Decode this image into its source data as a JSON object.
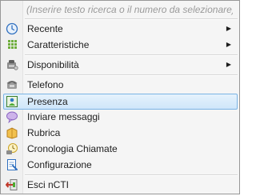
{
  "menu": {
    "search": {
      "placeholder": "(Inserire testo ricerca o il numero da selezionare)"
    },
    "items": [
      {
        "label": "Recente",
        "icon": "clock-icon",
        "submenu": true
      },
      {
        "label": "Caratteristiche",
        "icon": "grid-icon",
        "submenu": true
      },
      {
        "label": "Disponibilità",
        "icon": "phone-status-icon",
        "submenu": true
      },
      {
        "label": "Telefono",
        "icon": "telephone-icon",
        "submenu": false
      },
      {
        "label": "Presenza",
        "icon": "presence-icon",
        "submenu": false,
        "selected": true
      },
      {
        "label": "Inviare messaggi",
        "icon": "speech-bubble-icon",
        "submenu": false
      },
      {
        "label": "Rubrica",
        "icon": "address-book-icon",
        "submenu": false
      },
      {
        "label": "Cronologia Chiamate",
        "icon": "call-history-icon",
        "submenu": false
      },
      {
        "label": "Configurazione",
        "icon": "configuration-icon",
        "submenu": false
      },
      {
        "label": "Esci nCTI",
        "icon": "exit-icon",
        "submenu": false
      }
    ],
    "submenu_arrow": "▶"
  },
  "colors": {
    "highlight_border": "#7ab3e5",
    "highlight_fill": "#cfe6fa",
    "placeholder_text": "#9a9a9a"
  }
}
